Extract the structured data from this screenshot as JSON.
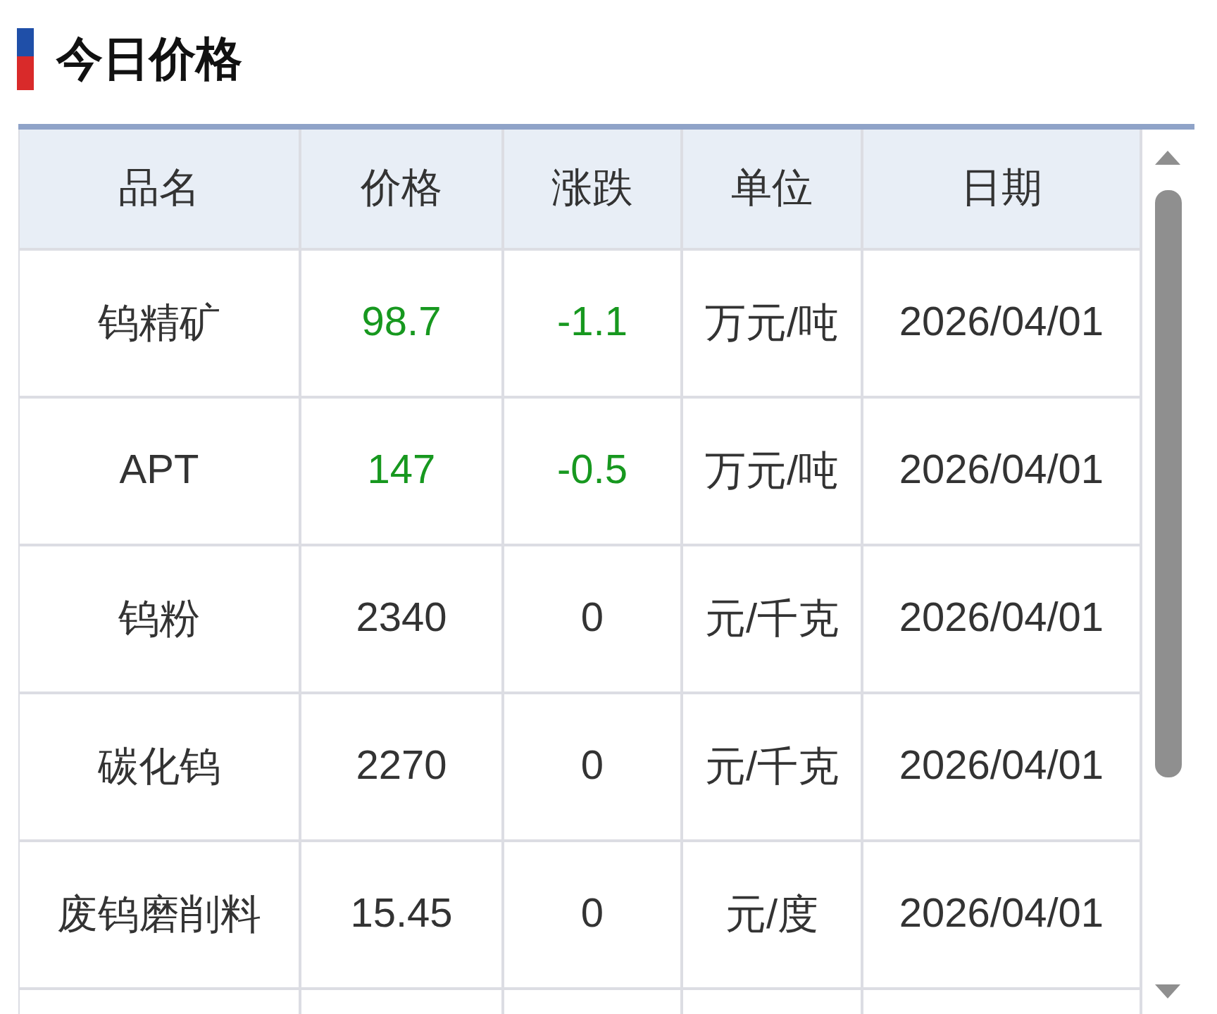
{
  "title": "今日价格",
  "table": {
    "columns": [
      "品名",
      "价格",
      "涨跌",
      "单位",
      "日期"
    ],
    "rows": [
      {
        "color": "#17981f",
        "cells": [
          "钨精矿",
          "98.7",
          "-1.1",
          "万元/吨",
          "2026/04/01"
        ]
      },
      {
        "color": "#17981f",
        "cells": [
          "APT",
          "147",
          "-0.5",
          "万元/吨",
          "2026/04/01"
        ]
      },
      {
        "color": "#333333",
        "cells": [
          "钨粉",
          "2340",
          "0",
          "元/千克",
          "2026/04/01"
        ]
      },
      {
        "color": "#333333",
        "cells": [
          "碳化钨",
          "2270",
          "0",
          "元/千克",
          "2026/04/01"
        ]
      },
      {
        "color": "#333333",
        "cells": [
          "废钨磨削料",
          "15.45",
          "0",
          "元/度",
          "2026/04/01"
        ]
      }
    ]
  }
}
